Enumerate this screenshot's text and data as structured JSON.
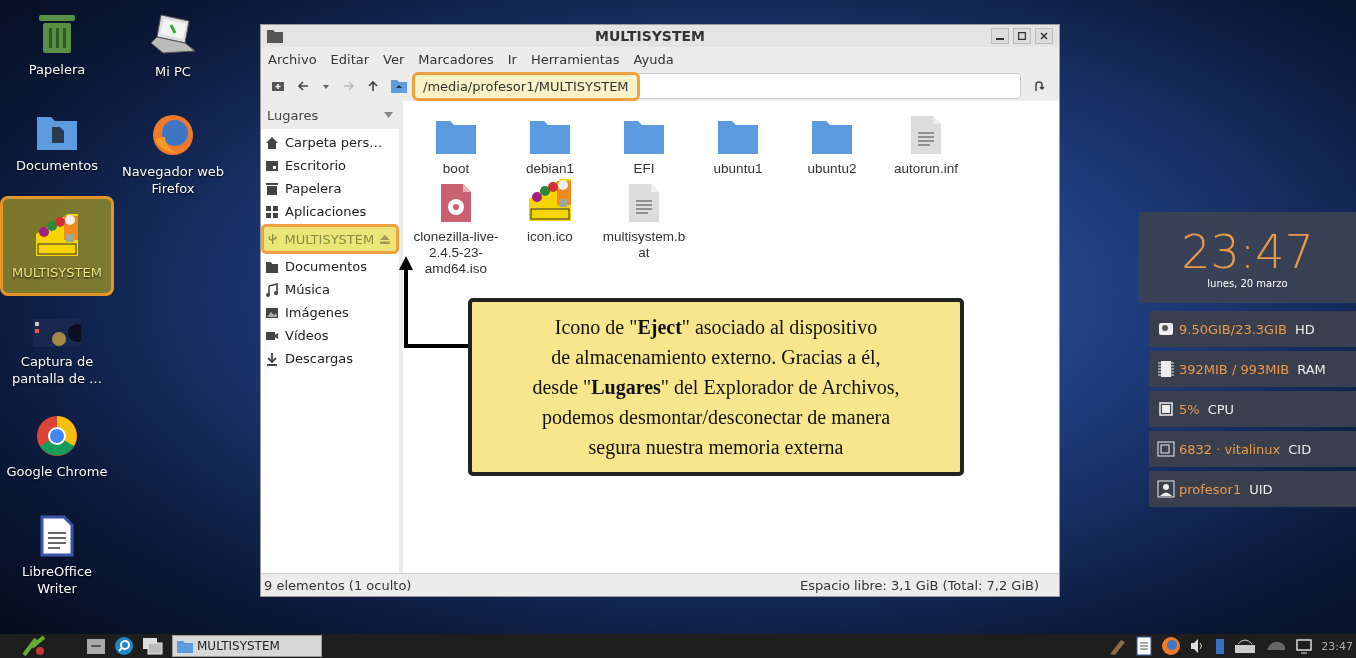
{
  "desktop_icons": [
    {
      "label": "Papelera",
      "kind": "trash",
      "selected": false
    },
    {
      "label": "Mi PC",
      "kind": "computer",
      "selected": false
    },
    {
      "label": "Documentos",
      "kind": "folder",
      "selected": false
    },
    {
      "label": "Navegador web Firefox",
      "kind": "firefox",
      "selected": false
    },
    {
      "label": "MULTISYSTEM",
      "kind": "multisystem",
      "selected": true
    },
    {
      "label": "Captura de pantalla de …",
      "kind": "screenshot",
      "selected": false
    },
    {
      "label": "Google Chrome",
      "kind": "chrome",
      "selected": false
    },
    {
      "label": "LibreOffice Writer",
      "kind": "writer",
      "selected": false
    }
  ],
  "window": {
    "title": "MULTISYSTEM",
    "menu": [
      "Archivo",
      "Editar",
      "Ver",
      "Marcadores",
      "Ir",
      "Herramientas",
      "Ayuda"
    ],
    "location": {
      "value": "/media/profesor1/MULTISYSTEM",
      "highlighted": true
    },
    "sidebar": {
      "title": "Lugares",
      "items": [
        {
          "label": "Carpeta pers…",
          "kind": "home",
          "selected": false
        },
        {
          "label": "Escritorio",
          "kind": "desktop",
          "selected": false
        },
        {
          "label": "Papelera",
          "kind": "trash",
          "selected": false
        },
        {
          "label": "Aplicaciones",
          "kind": "apps",
          "selected": false
        },
        {
          "label": "MULTISYSTEM",
          "kind": "usb",
          "selected": true,
          "eject": true
        },
        {
          "label": "Documentos",
          "kind": "folder",
          "selected": false
        },
        {
          "label": "Música",
          "kind": "music",
          "selected": false
        },
        {
          "label": "Imágenes",
          "kind": "image",
          "selected": false
        },
        {
          "label": "Vídeos",
          "kind": "video",
          "selected": false
        },
        {
          "label": "Descargas",
          "kind": "download",
          "selected": false
        }
      ]
    },
    "files": [
      {
        "name": "boot",
        "kind": "folder"
      },
      {
        "name": "debian1",
        "kind": "folder"
      },
      {
        "name": "EFI",
        "kind": "folder"
      },
      {
        "name": "ubuntu1",
        "kind": "folder"
      },
      {
        "name": "ubuntu2",
        "kind": "folder"
      },
      {
        "name": "autorun.inf",
        "kind": "text"
      },
      {
        "name": "clonezilla-live-2.4.5-23-amd64.iso",
        "kind": "disc"
      },
      {
        "name": "icon.ico",
        "kind": "multisystem"
      },
      {
        "name": "multisystem.bat",
        "kind": "text"
      }
    ],
    "status_left": "9 elementos (1 oculto)",
    "status_right": "Espacio libre: 3,1 GiB (Total: 7,2 GiB)"
  },
  "callout": {
    "lines": [
      "Icono de \"**Eject**\" asociado al dispositivo",
      "de almacenamiento externo.  Gracias a él,",
      "desde \"**Lugares**\" del Explorador de Archivos,",
      "podemos desmontar/desconectar de manera",
      "segura nuestra memoria externa"
    ]
  },
  "clock": {
    "time": "23:47",
    "date": "lunes, 20 marzo"
  },
  "stats": [
    {
      "kind": "disk",
      "value": "9.50GIB/23.3GIB",
      "label": "HD"
    },
    {
      "kind": "ram",
      "value": "392MIB / 993MIB",
      "label": "RAM"
    },
    {
      "kind": "cpu",
      "value": "5%",
      "label": "CPU"
    },
    {
      "kind": "id",
      "value": "6832 · vitalinux",
      "label": "CID"
    },
    {
      "kind": "user",
      "value": "profesor1",
      "label": "UID"
    }
  ],
  "taskbar": {
    "task": "MULTISYSTEM",
    "clock": "23:47"
  }
}
